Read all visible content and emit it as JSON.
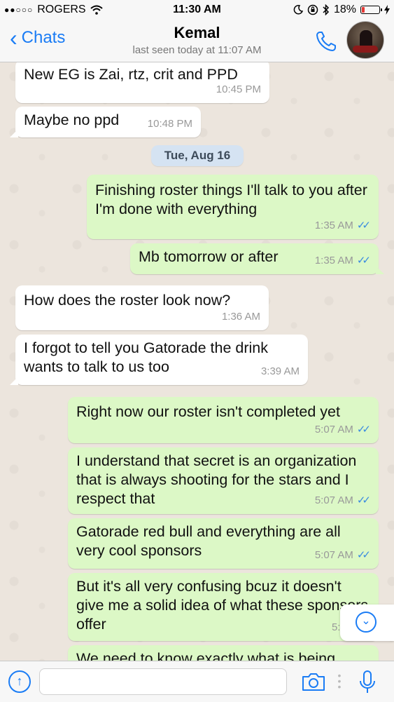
{
  "status_bar": {
    "signal": "●●○○○",
    "carrier": "ROGERS",
    "time": "11:30 AM",
    "battery": "18%",
    "battery_level": 0.18
  },
  "header": {
    "back_label": "Chats",
    "contact_name": "Kemal",
    "last_seen": "last seen today at 11:07 AM"
  },
  "messages": [
    {
      "dir": "in",
      "text": "New EG is Zai, rtz, crit and PPD",
      "time": "10:45 PM"
    },
    {
      "dir": "in",
      "text": "Maybe no ppd",
      "time": "10:48 PM"
    },
    {
      "dir": "in",
      "text": "How does the roster look now?",
      "time": "1:36 AM"
    },
    {
      "dir": "in",
      "text": "I forgot to tell you Gatorade the drink wants to talk to us too",
      "time": "3:39 AM"
    },
    {
      "dir": "out",
      "text": "Finishing roster things I'll talk to you after I'm done with everything",
      "time": "1:35 AM"
    },
    {
      "dir": "out",
      "text": "Mb tomorrow or after",
      "time": "1:35 AM"
    },
    {
      "dir": "out",
      "text": "Right now our roster isn't completed yet",
      "time": "5:07 AM"
    },
    {
      "dir": "out",
      "text": "I understand that secret is an organization that is always shooting for the stars and I respect that",
      "time": "5:07 AM"
    },
    {
      "dir": "out",
      "text": "Gatorade red bull and everything are all very cool sponsors",
      "time": "5:07 AM"
    },
    {
      "dir": "out",
      "text": "But it's all very confusing bcuz it doesn't give me a solid idea of what these sponsors offer",
      "time": "5:08 AM"
    },
    {
      "dir": "out",
      "text": "We need to know exactly what is being",
      "time": ""
    }
  ],
  "date_separator": "Tue, Aug 16",
  "read_ticks": "✓✓",
  "composer": {
    "placeholder": "",
    "value": ""
  },
  "icons": {
    "back": "chevron-left-icon",
    "call": "phone-icon",
    "scroll_down": "chevron-down-circle-icon",
    "attach": "arrow-up-circle-icon",
    "camera": "camera-icon",
    "mic": "microphone-icon"
  },
  "colors": {
    "accent": "#1a7cf5",
    "outgoing_bubble": "#dcf8c6",
    "incoming_bubble": "#ffffff",
    "read_tick": "#3a8be0",
    "date_pill": "#d5e3f2"
  }
}
